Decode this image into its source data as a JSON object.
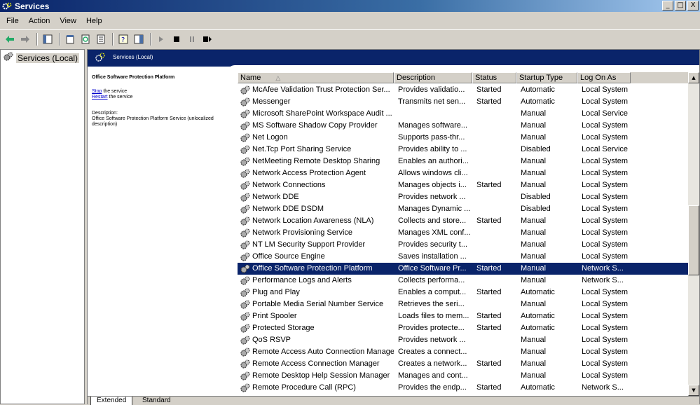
{
  "window": {
    "title": "Services"
  },
  "window_buttons": [
    "_",
    "□",
    "X"
  ],
  "menu": [
    "File",
    "Action",
    "View",
    "Help"
  ],
  "tree": {
    "root": "Services (Local)"
  },
  "banner": {
    "title": "Services (Local)"
  },
  "detail": {
    "service_name": "Office Software Protection Platform",
    "stop_link": "Stop",
    "stop_suffix": " the service",
    "restart_link": "Restart",
    "restart_suffix": " the service",
    "description_label": "Description:",
    "description_text": "Office Software Protection Platform Service (unlocalized description)"
  },
  "columns": [
    "Name",
    "Description",
    "Status",
    "Startup Type",
    "Log On As"
  ],
  "services": [
    {
      "name": "McAfee Validation Trust Protection Ser...",
      "desc": "Provides validatio...",
      "status": "Started",
      "startup": "Automatic",
      "logon": "Local System"
    },
    {
      "name": "Messenger",
      "desc": "Transmits net sen...",
      "status": "Started",
      "startup": "Automatic",
      "logon": "Local System"
    },
    {
      "name": "Microsoft SharePoint Workspace Audit ...",
      "desc": "",
      "status": "",
      "startup": "Manual",
      "logon": "Local Service"
    },
    {
      "name": "MS Software Shadow Copy Provider",
      "desc": "Manages software...",
      "status": "",
      "startup": "Manual",
      "logon": "Local System"
    },
    {
      "name": "Net Logon",
      "desc": "Supports pass-thr...",
      "status": "",
      "startup": "Manual",
      "logon": "Local System"
    },
    {
      "name": "Net.Tcp Port Sharing Service",
      "desc": "Provides ability to ...",
      "status": "",
      "startup": "Disabled",
      "logon": "Local Service"
    },
    {
      "name": "NetMeeting Remote Desktop Sharing",
      "desc": "Enables an authori...",
      "status": "",
      "startup": "Manual",
      "logon": "Local System"
    },
    {
      "name": "Network Access Protection Agent",
      "desc": "Allows windows cli...",
      "status": "",
      "startup": "Manual",
      "logon": "Local System"
    },
    {
      "name": "Network Connections",
      "desc": "Manages objects i...",
      "status": "Started",
      "startup": "Manual",
      "logon": "Local System"
    },
    {
      "name": "Network DDE",
      "desc": "Provides network ...",
      "status": "",
      "startup": "Disabled",
      "logon": "Local System"
    },
    {
      "name": "Network DDE DSDM",
      "desc": "Manages Dynamic ...",
      "status": "",
      "startup": "Disabled",
      "logon": "Local System"
    },
    {
      "name": "Network Location Awareness (NLA)",
      "desc": "Collects and store...",
      "status": "Started",
      "startup": "Manual",
      "logon": "Local System"
    },
    {
      "name": "Network Provisioning Service",
      "desc": "Manages XML conf...",
      "status": "",
      "startup": "Manual",
      "logon": "Local System"
    },
    {
      "name": "NT LM Security Support Provider",
      "desc": "Provides security t...",
      "status": "",
      "startup": "Manual",
      "logon": "Local System"
    },
    {
      "name": "Office  Source Engine",
      "desc": "Saves installation ...",
      "status": "",
      "startup": "Manual",
      "logon": "Local System"
    },
    {
      "name": "Office Software Protection Platform",
      "desc": "Office Software Pr...",
      "status": "Started",
      "startup": "Manual",
      "logon": "Network S...",
      "selected": true
    },
    {
      "name": "Performance Logs and Alerts",
      "desc": "Collects performa...",
      "status": "",
      "startup": "Manual",
      "logon": "Network S..."
    },
    {
      "name": "Plug and Play",
      "desc": "Enables a comput...",
      "status": "Started",
      "startup": "Automatic",
      "logon": "Local System"
    },
    {
      "name": "Portable Media Serial Number Service",
      "desc": "Retrieves the seri...",
      "status": "",
      "startup": "Manual",
      "logon": "Local System"
    },
    {
      "name": "Print Spooler",
      "desc": "Loads files to mem...",
      "status": "Started",
      "startup": "Automatic",
      "logon": "Local System"
    },
    {
      "name": "Protected Storage",
      "desc": "Provides protecte...",
      "status": "Started",
      "startup": "Automatic",
      "logon": "Local System"
    },
    {
      "name": "QoS RSVP",
      "desc": "Provides network ...",
      "status": "",
      "startup": "Manual",
      "logon": "Local System"
    },
    {
      "name": "Remote Access Auto Connection Manager",
      "desc": "Creates a connect...",
      "status": "",
      "startup": "Manual",
      "logon": "Local System"
    },
    {
      "name": "Remote Access Connection Manager",
      "desc": "Creates a network...",
      "status": "Started",
      "startup": "Manual",
      "logon": "Local System"
    },
    {
      "name": "Remote Desktop Help Session Manager",
      "desc": "Manages and cont...",
      "status": "",
      "startup": "Manual",
      "logon": "Local System"
    },
    {
      "name": "Remote Procedure Call (RPC)",
      "desc": "Provides the endp...",
      "status": "Started",
      "startup": "Automatic",
      "logon": "Network S..."
    }
  ],
  "tabs": [
    "Extended",
    "Standard"
  ]
}
